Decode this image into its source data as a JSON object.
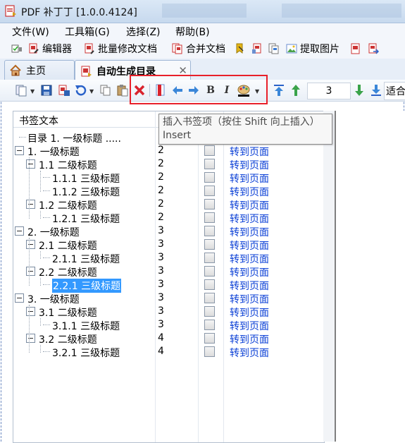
{
  "window": {
    "title": "PDF 补丁丁 [1.0.0.4124]"
  },
  "menu": [
    "文件(W)",
    "工具箱(G)",
    "选择(Z)",
    "帮助(B)"
  ],
  "commands": [
    "编辑器",
    "批量修改文档",
    "合并文档",
    "提取图片"
  ],
  "tabs": [
    {
      "label": "主页",
      "icon": "home-icon"
    },
    {
      "label": "自动生成目录",
      "icon": "pdf-icon"
    }
  ],
  "toolbar": {
    "level_value": "3",
    "fit_label": "适合"
  },
  "grid": {
    "header": {
      "text_col": "书签文本"
    },
    "rows": [
      {
        "text": "目录 1. 一级标题 .....",
        "page": "",
        "level": 0,
        "expander": false,
        "link": ""
      },
      {
        "text": "1. 一级标题",
        "page": "2",
        "level": 0,
        "expander": true,
        "link": "转到页面"
      },
      {
        "text": "1.1 二级标题",
        "page": "2",
        "level": 1,
        "expander": true,
        "link": "转到页面"
      },
      {
        "text": "1.1.1 三级标题",
        "page": "2",
        "level": 2,
        "expander": false,
        "link": "转到页面"
      },
      {
        "text": "1.1.2 三级标题",
        "page": "2",
        "level": 2,
        "expander": false,
        "link": "转到页面"
      },
      {
        "text": "1.2 二级标题",
        "page": "2",
        "level": 1,
        "expander": true,
        "link": "转到页面"
      },
      {
        "text": "1.2.1 三级标题",
        "page": "2",
        "level": 2,
        "expander": false,
        "link": "转到页面"
      },
      {
        "text": "2. 一级标题",
        "page": "3",
        "level": 0,
        "expander": true,
        "link": "转到页面"
      },
      {
        "text": "2.1 二级标题",
        "page": "3",
        "level": 1,
        "expander": true,
        "link": "转到页面"
      },
      {
        "text": "2.1.1 三级标题",
        "page": "3",
        "level": 2,
        "expander": false,
        "link": "转到页面"
      },
      {
        "text": "2.2 二级标题",
        "page": "3",
        "level": 1,
        "expander": true,
        "link": "转到页面"
      },
      {
        "text": "2.2.1 三级标题",
        "page": "3",
        "level": 2,
        "expander": false,
        "link": "转到页面",
        "selected": true
      },
      {
        "text": "3. 一级标题",
        "page": "3",
        "level": 0,
        "expander": true,
        "link": "转到页面"
      },
      {
        "text": "3.1 二级标题",
        "page": "3",
        "level": 1,
        "expander": true,
        "link": "转到页面"
      },
      {
        "text": "3.1.1 三级标题",
        "page": "3",
        "level": 2,
        "expander": false,
        "link": "转到页面"
      },
      {
        "text": "3.2 二级标题",
        "page": "4",
        "level": 1,
        "expander": true,
        "link": "转到页面"
      },
      {
        "text": "3.2.1 三级标题",
        "page": "4",
        "level": 2,
        "expander": false,
        "link": "转到页面"
      }
    ]
  },
  "tooltip": {
    "line1": "插入书签项（按住 Shift 向上插入）",
    "line2": "Insert"
  },
  "colors": {
    "link": "#0a3fd6",
    "selection": "#3399ff",
    "highlight_box": "#e8202a"
  }
}
